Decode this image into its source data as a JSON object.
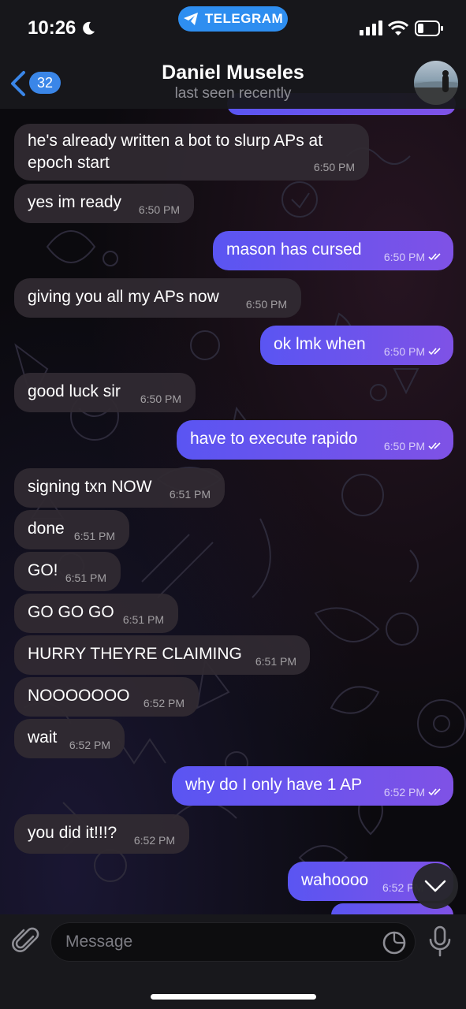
{
  "status_bar": {
    "time": "10:26",
    "app_pill": "TELEGRAM"
  },
  "header": {
    "back_count": "32",
    "name": "Daniel Museles",
    "status": "last seen recently"
  },
  "messages": [
    {
      "dir": "in",
      "text": "he's already written a bot to slurp APs at",
      "text2": "epoch start",
      "time": "6:50 PM"
    },
    {
      "dir": "in",
      "text": "yes im ready",
      "time": "6:50 PM"
    },
    {
      "dir": "out",
      "text": "mason has cursed",
      "time": "6:50 PM"
    },
    {
      "dir": "in",
      "text": "giving you all my APs now",
      "time": "6:50 PM"
    },
    {
      "dir": "out",
      "text": "ok lmk when",
      "time": "6:50 PM"
    },
    {
      "dir": "in",
      "text": "good luck sir",
      "time": "6:50 PM"
    },
    {
      "dir": "out",
      "text": "have to execute rapido",
      "time": "6:50 PM"
    },
    {
      "dir": "in",
      "text": "signing txn NOW",
      "time": "6:51 PM"
    },
    {
      "dir": "in",
      "text": "done",
      "time": "6:51 PM"
    },
    {
      "dir": "in",
      "text": "GO!",
      "time": "6:51 PM"
    },
    {
      "dir": "in",
      "text": "GO GO GO",
      "time": "6:51 PM"
    },
    {
      "dir": "in",
      "text": "HURRY THEYRE CLAIMING",
      "time": "6:51 PM"
    },
    {
      "dir": "in",
      "text": "NOOOOOOO",
      "time": "6:52 PM"
    },
    {
      "dir": "in",
      "text": "wait",
      "time": "6:52 PM"
    },
    {
      "dir": "out",
      "text": "why do I only have 1 AP",
      "time": "6:52 PM"
    },
    {
      "dir": "in",
      "text": "you did it!!!?",
      "time": "6:52 PM"
    },
    {
      "dir": "out",
      "text": "wahoooo",
      "time": "6:52 PM"
    }
  ],
  "composer": {
    "placeholder": "Message"
  },
  "colors": {
    "accent": "#3a86e8",
    "outgoing": "#6a54ee",
    "incoming": "#302a32"
  }
}
